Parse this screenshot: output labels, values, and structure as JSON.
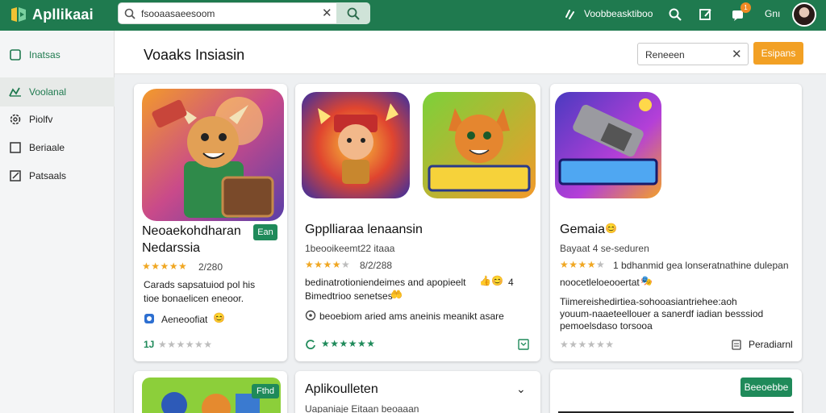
{
  "app": {
    "title": "Apllikaai"
  },
  "search": {
    "value": "fsooaasaeesoom",
    "clear": "✕"
  },
  "topbar": {
    "link_text": "Voobbeasktiboo",
    "user_text": "Gnı",
    "badge_count": "1"
  },
  "sidebar": {
    "items": [
      {
        "label": "Inatsas"
      },
      {
        "label": "Voolanal"
      },
      {
        "label": "Piolfv"
      },
      {
        "label": "Beriaale"
      },
      {
        "label": "Patsaals"
      }
    ]
  },
  "header": {
    "title": "Voaaks Insiasin",
    "filter_value": "Reneeen",
    "filter_clear": "✕",
    "action_label": "Esipans"
  },
  "cards": [
    {
      "title_line1": "Neoaekohdharan",
      "title_line2": "Nedarssia",
      "pill": "Ean",
      "rating_text": "2/280",
      "desc_line1": "Carads sapsatuiod pol his",
      "desc_line2": "tioe bonaelicen eneoor.",
      "author": "Aeneoofiat",
      "footer_prefix": "1J"
    },
    {
      "title": "Gpplliaraa lenaansin",
      "subtitle": "1beooikeemt22 itaaa",
      "rating_text": "8/2/288",
      "desc_line1": "bedinatrotioniendeimes and apopieelt",
      "desc_line1_suffix": "4",
      "desc_line2": "Bimedtrioo senetses",
      "meta": "beoebiom aried ams aneinis meanikt asare"
    },
    {
      "title": "Gemaia",
      "subtitle": "Bayaat 4 se-seduren",
      "rating_text": "1 bdhanmid gea lonseratnathine dulepan",
      "desc_line1": "noocetleloeooertat",
      "desc_line2": "Tiimereishedirtiea-sohooasiantriehee:aoh",
      "desc_line3": "youum-naaeteellouer a sanerdf iadian besssiod",
      "desc_line4": "pemoelsdaso torsooa",
      "action": "Peradiarnl"
    },
    {
      "pill": "Fthd"
    },
    {
      "title": "Aplikoulleten",
      "subtitle": "Uapaniaje Eitaan beoaaan"
    },
    {
      "button": "Beeoebbe"
    }
  ],
  "colors": {
    "brand": "#1f7a4f",
    "accent": "#f2a024",
    "star": "#f0a722"
  }
}
